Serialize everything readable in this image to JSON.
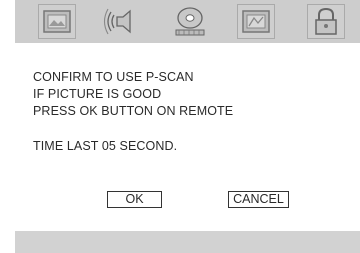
{
  "tabs": [
    {
      "icon": "picture-icon"
    },
    {
      "icon": "audio-speaker-icon"
    },
    {
      "icon": "disc-film-icon"
    },
    {
      "icon": "photo-slide-icon"
    },
    {
      "icon": "lock-icon"
    }
  ],
  "dialog": {
    "line1": "CONFIRM TO USE P-SCAN",
    "line2": "IF PICTURE IS GOOD",
    "line3": "PRESS OK BUTTON ON REMOTE",
    "timer": "TIME LAST 05 SECOND."
  },
  "buttons": {
    "ok_label": "OK",
    "cancel_label": "CANCEL"
  },
  "colors": {
    "bar": "#cdcdcd",
    "background": "#ffffff",
    "text": "#2a2a2a"
  }
}
